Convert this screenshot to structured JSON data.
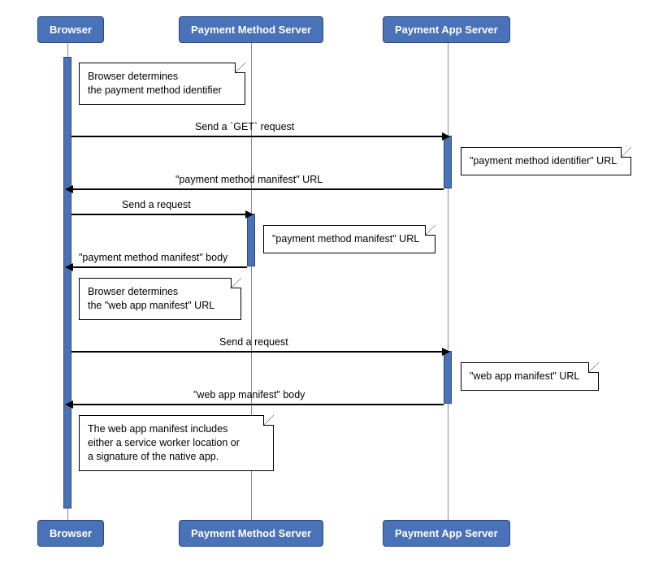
{
  "participants": {
    "browser": "Browser",
    "pms": "Payment Method Server",
    "pas": "Payment App Server"
  },
  "notes": {
    "n1_l1": "Browser determines",
    "n1_l2": "the payment method identifier",
    "n2": "\"payment method identifier\" URL",
    "n3": "\"payment method manifest\" URL",
    "n4_l1": "Browser determines",
    "n4_l2": "the \"web app manifest\" URL",
    "n5": "\"web app manifest\" URL",
    "n6_l1": "The web app manifest includes",
    "n6_l2": "either a service worker location or",
    "n6_l3": "a signature of the native app."
  },
  "messages": {
    "m1": "Send a `GET` request",
    "m2": "\"payment method manifest\" URL",
    "m3": "Send a request",
    "m4": "\"payment method manifest\" body",
    "m5": "Send a request",
    "m6": "\"web app manifest\" body"
  }
}
